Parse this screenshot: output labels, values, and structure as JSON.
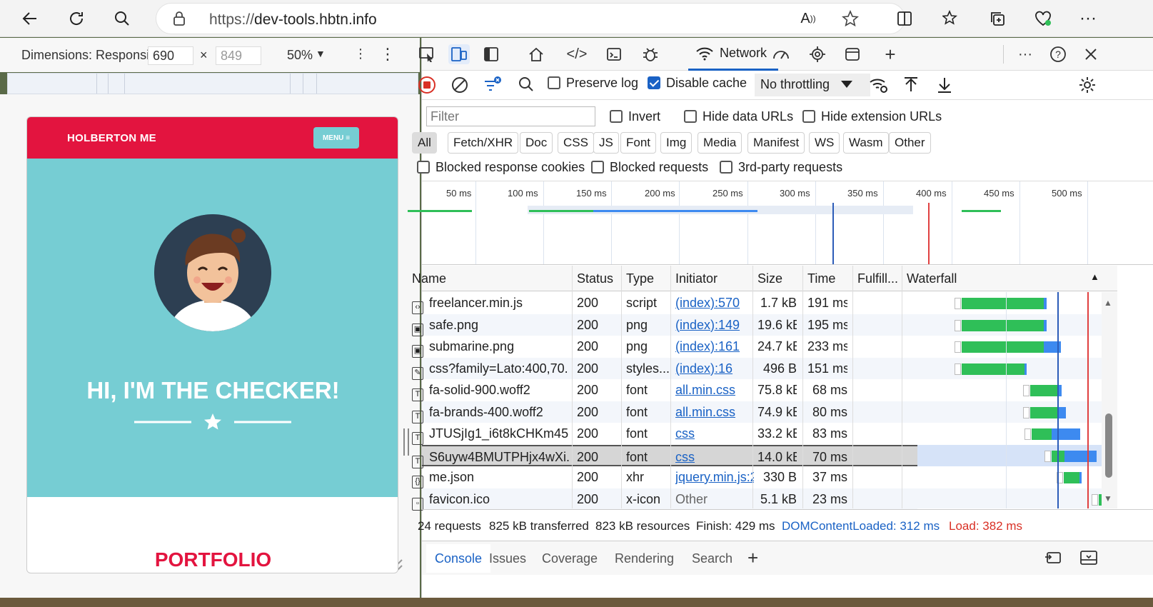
{
  "browser": {
    "url_scheme": "https://",
    "url_host": "dev-tools.hbtn.info"
  },
  "device_toolbar": {
    "label": "Dimensions: Responsi",
    "width": "690",
    "height": "849",
    "zoom": "50%"
  },
  "site": {
    "brand": "HOLBERTON ME",
    "menu": "MENU",
    "hero_title": "HI, I'M THE CHECKER!",
    "section_title": "PORTFOLIO"
  },
  "devtools": {
    "network_tab": "Network",
    "preserve_log": "Preserve log",
    "disable_cache": "Disable cache",
    "throttling": "No throttling",
    "filter_placeholder": "Filter",
    "invert": "Invert",
    "hide_data_urls": "Hide data URLs",
    "hide_extension_urls": "Hide extension URLs",
    "type_filters": [
      "All",
      "Fetch/XHR",
      "Doc",
      "CSS",
      "JS",
      "Font",
      "Img",
      "Media",
      "Manifest",
      "WS",
      "Wasm",
      "Other"
    ],
    "blocked_response_cookies": "Blocked response cookies",
    "blocked_requests": "Blocked requests",
    "third_party_requests": "3rd-party requests",
    "overview_labels": [
      "50 ms",
      "100 ms",
      "150 ms",
      "200 ms",
      "250 ms",
      "300 ms",
      "350 ms",
      "400 ms",
      "450 ms",
      "500 ms"
    ],
    "columns": [
      "Name",
      "Status",
      "Type",
      "Initiator",
      "Size",
      "Time",
      "Fulfill...",
      "Waterfall"
    ],
    "rows": [
      {
        "name": "freelancer.min.js",
        "status": "200",
        "type": "script",
        "initiator": "(index):570",
        "size": "1.7 kB",
        "time": "191 ms",
        "icon": "script-file-icon"
      },
      {
        "name": "safe.png",
        "status": "200",
        "type": "png",
        "initiator": "(index):149",
        "size": "19.6 kB",
        "time": "195 ms",
        "icon": "image-file-icon"
      },
      {
        "name": "submarine.png",
        "status": "200",
        "type": "png",
        "initiator": "(index):161",
        "size": "24.7 kB",
        "time": "233 ms",
        "icon": "image-file-icon"
      },
      {
        "name": "css?family=Lato:400,70...",
        "status": "200",
        "type": "styles...",
        "initiator": "(index):16",
        "size": "496 B",
        "time": "151 ms",
        "icon": "stylesheet-file-icon"
      },
      {
        "name": "fa-solid-900.woff2",
        "status": "200",
        "type": "font",
        "initiator": "all.min.css",
        "size": "75.8 kB",
        "time": "68 ms",
        "icon": "font-file-icon"
      },
      {
        "name": "fa-brands-400.woff2",
        "status": "200",
        "type": "font",
        "initiator": "all.min.css",
        "size": "74.9 kB",
        "time": "80 ms",
        "icon": "font-file-icon"
      },
      {
        "name": "JTUSjIg1_i6t8kCHKm45...",
        "status": "200",
        "type": "font",
        "initiator": "css",
        "size": "33.2 kB",
        "time": "83 ms",
        "icon": "font-file-icon"
      },
      {
        "name": "S6uyw4BMUTPHjx4wXi...",
        "status": "200",
        "type": "font",
        "initiator": "css",
        "size": "14.0 kB",
        "time": "70 ms",
        "icon": "font-file-icon"
      },
      {
        "name": "me.json",
        "status": "200",
        "type": "xhr",
        "initiator": "jquery.min.js:2",
        "size": "330 B",
        "time": "37 ms",
        "icon": "json-file-icon"
      },
      {
        "name": "favicon.ico",
        "status": "200",
        "type": "x-icon",
        "initiator": "Other",
        "size": "5.1 kB",
        "time": "23 ms",
        "icon": "icon-file-icon"
      }
    ],
    "summary": {
      "requests": "24 requests",
      "transferred": "825 kB transferred",
      "resources": "823 kB resources",
      "finish": "Finish: 429 ms",
      "dom_loaded": "DOMContentLoaded: 312 ms",
      "load": "Load: 382 ms"
    },
    "drawer_tabs": [
      "Console",
      "Issues",
      "Coverage",
      "Rendering",
      "Search"
    ]
  },
  "colors": {
    "accent": "#1a62c5",
    "brand_red": "#e3143f",
    "hero_teal": "#76cdd3",
    "bar_green": "#2fbf58",
    "bar_blue": "#3d8af0"
  }
}
